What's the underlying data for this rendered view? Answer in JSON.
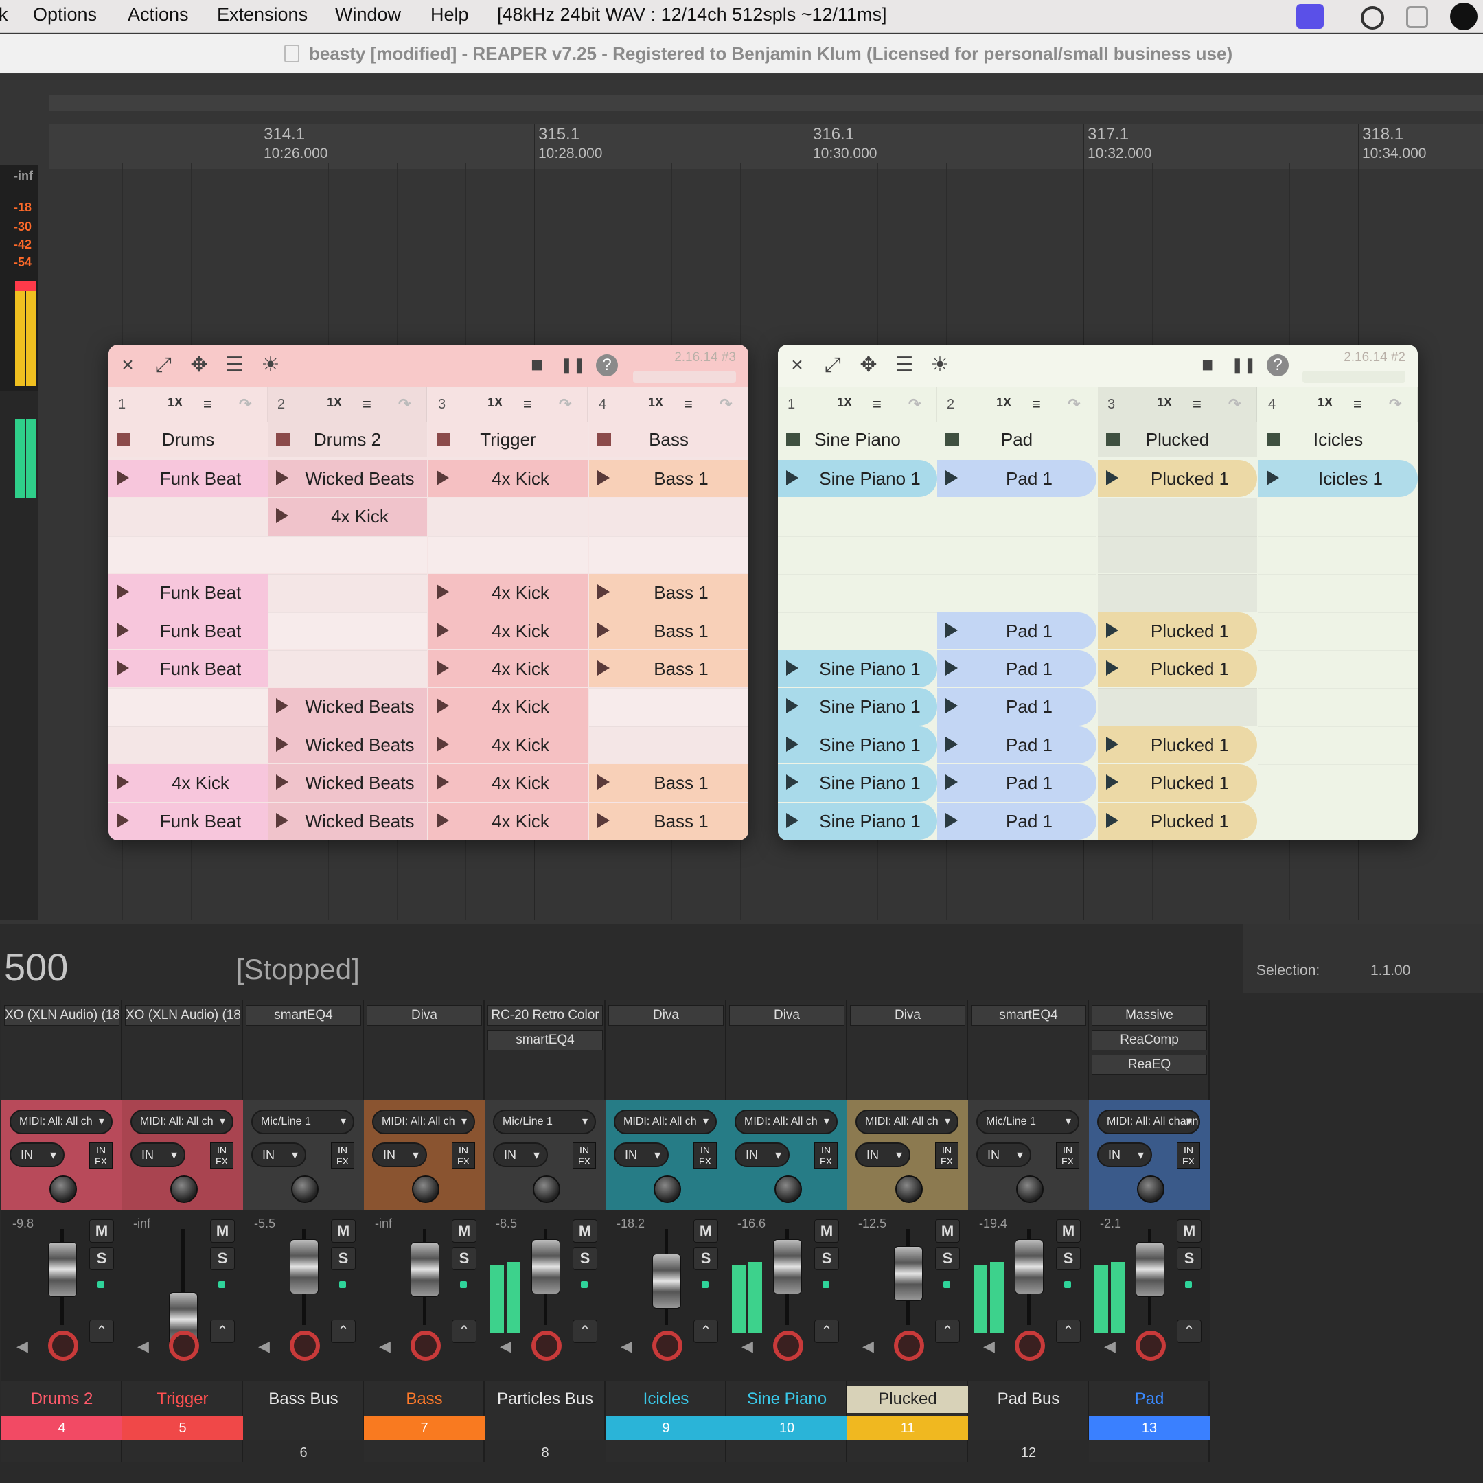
{
  "menubar": {
    "items": [
      "Options",
      "Actions",
      "Extensions",
      "Window",
      "Help"
    ],
    "status": "[48kHz 24bit WAV : 12/14ch 512spls ~12/11ms]"
  },
  "window": {
    "title": "beasty [modified] - REAPER v7.25 - Registered to Benjamin Klum (Licensed for personal/small business use)"
  },
  "ruler": {
    "marks": [
      {
        "bar": "314.1",
        "time": "10:26.000"
      },
      {
        "bar": "315.1",
        "time": "10:28.000"
      },
      {
        "bar": "316.1",
        "time": "10:30.000"
      },
      {
        "bar": "317.1",
        "time": "10:32.000"
      },
      {
        "bar": "318.1",
        "time": "10:34.000"
      }
    ]
  },
  "meter_scale": [
    "-inf",
    "-18",
    "-30",
    "-42",
    "-54"
  ],
  "clip_windows": [
    {
      "version": "2.16.14 #3",
      "bg": "#f5e4e4",
      "toolbar_bg": "#f8c9c9",
      "columns": [
        {
          "num": "1",
          "speed": "1X",
          "track": "Drums",
          "color": "#f7c6dc"
        },
        {
          "num": "2",
          "speed": "1X",
          "track": "Drums 2",
          "color": "#f0c3cb"
        },
        {
          "num": "3",
          "speed": "1X",
          "track": "Trigger",
          "color": "#f5c0c2"
        },
        {
          "num": "4",
          "speed": "1X",
          "track": "Bass",
          "color": "#f8d0b8"
        }
      ],
      "rows": [
        [
          "Funk Beat",
          "Wicked Beats",
          "4x Kick",
          "Bass 1"
        ],
        [
          "",
          "4x Kick",
          "",
          ""
        ],
        [
          "",
          "",
          "",
          ""
        ],
        [
          "Funk Beat",
          "",
          "4x Kick",
          "Bass 1"
        ],
        [
          "Funk Beat",
          "",
          "4x Kick",
          "Bass 1"
        ],
        [
          "Funk Beat",
          "",
          "4x Kick",
          "Bass 1"
        ],
        [
          "",
          "Wicked Beats",
          "4x Kick",
          ""
        ],
        [
          "",
          "Wicked Beats",
          "4x Kick",
          ""
        ],
        [
          "4x Kick",
          "Wicked Beats",
          "4x Kick",
          "Bass 1"
        ],
        [
          "Funk Beat",
          "Wicked Beats",
          "4x Kick",
          "Bass 1"
        ]
      ]
    },
    {
      "version": "2.16.14 #2",
      "bg": "#eef3e6",
      "toolbar_bg": "#f3f6ec",
      "columns": [
        {
          "num": "1",
          "speed": "1X",
          "track": "Sine Piano",
          "color": "#a9daea"
        },
        {
          "num": "2",
          "speed": "1X",
          "track": "Pad",
          "color": "#c3d6f4"
        },
        {
          "num": "3",
          "speed": "1X",
          "track": "Plucked",
          "color": "#ecd9a6"
        },
        {
          "num": "4",
          "speed": "1X",
          "track": "Icicles",
          "color": "#b0dcea"
        }
      ],
      "rows": [
        [
          "Sine Piano 1",
          "Pad 1",
          "Plucked 1",
          "Icicles 1"
        ],
        [
          "",
          "",
          "",
          ""
        ],
        [
          "",
          "",
          "",
          ""
        ],
        [
          "",
          "",
          "",
          ""
        ],
        [
          "",
          "Pad 1",
          "Plucked 1",
          ""
        ],
        [
          "Sine Piano 1",
          "Pad 1",
          "Plucked 1",
          ""
        ],
        [
          "Sine Piano 1",
          "Pad 1",
          "",
          ""
        ],
        [
          "Sine Piano 1",
          "Pad 1",
          "Plucked 1",
          ""
        ],
        [
          "Sine Piano 1",
          "Pad 1",
          "Plucked 1",
          ""
        ],
        [
          "Sine Piano 1",
          "Pad 1",
          "Plucked 1",
          ""
        ]
      ]
    }
  ],
  "status": {
    "position": "500",
    "state": "[Stopped]",
    "selection_label": "Selection:",
    "selection_value": "1.1.00"
  },
  "mixer": {
    "strips": [
      {
        "fx": [
          "XO (XLN Audio) (18"
        ],
        "input": "MIDI: All: All ch",
        "in": "IN",
        "volume": "-9.8",
        "name": "Drums 2",
        "number": "4",
        "color": "#b84a5a",
        "name_color": "#ff5a6a",
        "num_bg": "#f24a64",
        "fader_level": 0.72,
        "meter_level": 0.0
      },
      {
        "fx": [
          "XO (XLN Audio) (18"
        ],
        "input": "MIDI: All: All ch",
        "in": "IN",
        "volume": "-inf",
        "name": "Trigger",
        "number": "5",
        "color": "#a94450",
        "name_color": "#ff5050",
        "num_bg": "#f04848",
        "fader_level": 0.2,
        "meter_level": 0.0
      },
      {
        "fx": [
          "smartEQ4"
        ],
        "input": "Mic/Line 1",
        "in": "IN",
        "volume": "-5.5",
        "name": "Bass Bus",
        "number": "6",
        "color": "#3a3a3a",
        "name_color": "#e8e8e8",
        "num_bg": "#2a2a2a",
        "fader_level": 0.75,
        "meter_level": 0.0
      },
      {
        "fx": [
          "Diva"
        ],
        "input": "MIDI: All: All ch",
        "in": "IN",
        "volume": "-inf",
        "name": "Bass",
        "number": "7",
        "color": "#8a5430",
        "name_color": "#ff7a2a",
        "num_bg": "#f97a20",
        "fader_level": 0.72,
        "meter_level": 0.0
      },
      {
        "fx": [
          "RC-20 Retro Color",
          "smartEQ4"
        ],
        "input": "Mic/Line 1",
        "in": "IN",
        "volume": "-8.5",
        "name": "Particles Bus",
        "number": "8",
        "color": "#3a3a3a",
        "name_color": "#e8e8e8",
        "num_bg": "#2a2a2a",
        "fader_level": 0.75,
        "meter_level": 0.55
      },
      {
        "fx": [
          "Diva"
        ],
        "input": "MIDI: All: All ch",
        "in": "IN",
        "volume": "-18.2",
        "name": "Icicles",
        "number": "9",
        "color": "#267c86",
        "name_color": "#3ac8e8",
        "num_bg": "#2ab4d8",
        "fader_level": 0.6,
        "meter_level": 0.0
      },
      {
        "fx": [
          "Diva"
        ],
        "input": "MIDI: All: All ch",
        "in": "IN",
        "volume": "-16.6",
        "name": "Sine Piano",
        "number": "10",
        "color": "#267c86",
        "name_color": "#3ac8e8",
        "num_bg": "#2ab4d8",
        "fader_level": 0.75,
        "meter_level": 0.55
      },
      {
        "fx": [
          "Diva"
        ],
        "input": "MIDI: All: All ch",
        "in": "IN",
        "volume": "-12.5",
        "name": "Plucked",
        "number": "11",
        "color": "#8c7a50",
        "name_color": "#222222",
        "num_bg": "#f0b820",
        "fader_level": 0.68,
        "meter_level": 0.0
      },
      {
        "fx": [
          "smartEQ4"
        ],
        "input": "Mic/Line 1",
        "in": "IN",
        "volume": "-19.4",
        "name": "Pad Bus",
        "number": "12",
        "color": "#3a3a3a",
        "name_color": "#e8e8e8",
        "num_bg": "#2a2a2a",
        "fader_level": 0.75,
        "meter_level": 0.55
      },
      {
        "fx": [
          "Massive",
          "ReaComp",
          "ReaEQ"
        ],
        "input": "MIDI: All: All channels",
        "in": "IN",
        "volume": "-2.1",
        "name": "Pad",
        "number": "13",
        "color": "#3a5a8a",
        "name_color": "#3a8aff",
        "num_bg": "#3a80ff",
        "fader_level": 0.72,
        "meter_level": 0.55
      }
    ],
    "m_label": "M",
    "s_label": "S",
    "infx_label": "IN FX"
  },
  "icons": {
    "close": "×",
    "expand": "⤢",
    "move": "✥",
    "menu": "☰",
    "sun": "☀",
    "stop": "■",
    "pause": "❚❚",
    "help": "?"
  }
}
